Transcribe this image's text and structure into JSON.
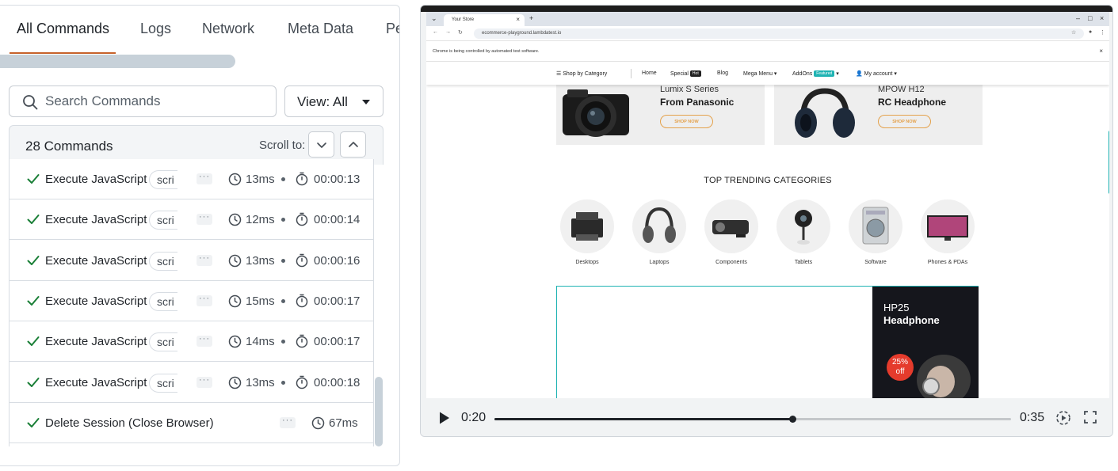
{
  "tabs": [
    "All Commands",
    "Logs",
    "Network",
    "Meta Data",
    "Pe"
  ],
  "search": {
    "placeholder": "Search Commands",
    "value": ""
  },
  "view_button": "View: All",
  "commands_header": {
    "count_label": "28 Commands",
    "scroll_to_label": "Scroll to:"
  },
  "commands": [
    {
      "name": "Execute JavaScript",
      "tag": "scri",
      "duration": "13ms",
      "timestamp": "00:00:13"
    },
    {
      "name": "Execute JavaScript",
      "tag": "scri",
      "duration": "12ms",
      "timestamp": "00:00:14"
    },
    {
      "name": "Execute JavaScript",
      "tag": "scri",
      "duration": "13ms",
      "timestamp": "00:00:16"
    },
    {
      "name": "Execute JavaScript",
      "tag": "scri",
      "duration": "15ms",
      "timestamp": "00:00:17"
    },
    {
      "name": "Execute JavaScript",
      "tag": "scri",
      "duration": "14ms",
      "timestamp": "00:00:17"
    },
    {
      "name": "Execute JavaScript",
      "tag": "scri",
      "duration": "13ms",
      "timestamp": "00:00:18"
    },
    {
      "name": "Delete Session (Close Browser)",
      "tag": "",
      "duration": "67ms",
      "timestamp": ""
    }
  ],
  "video": {
    "current_time": "0:20",
    "duration": "0:35",
    "progress": 0.578,
    "browser": {
      "tab_title": "Your Store",
      "address": "ecommerce-playground.lambdatest.io",
      "automation_warning": "Chrome is being controlled by automated test software.",
      "nav": {
        "shop_by_category": "Shop by Category",
        "home": "Home",
        "special": "Special",
        "special_badge": "Hot",
        "blog": "Blog",
        "mega_menu": "Mega Menu",
        "addons": "AddOns",
        "addons_badge": "Featured",
        "my_account": "My account"
      },
      "promos": [
        {
          "subtitle": "Lumix S Series",
          "title": "From Panasonic",
          "button": "SHOP NOW"
        },
        {
          "subtitle": "MPOW H12",
          "title": "RC Headphone",
          "button": "SHOP NOW"
        }
      ],
      "trending_title": "TOP TRENDING CATEGORIES",
      "categories": [
        "Desktops",
        "Laptops",
        "Components",
        "Tablets",
        "Software",
        "Phones & PDAs"
      ],
      "hp_banner": {
        "subtitle": "HP25",
        "title": "Headphone",
        "offer": "25%\noff"
      }
    }
  },
  "colors": {
    "accent_underline": "#c7622b",
    "check_green": "#1a7f37",
    "teal": "#1fb3b3",
    "offer_red": "#e53b2c"
  }
}
